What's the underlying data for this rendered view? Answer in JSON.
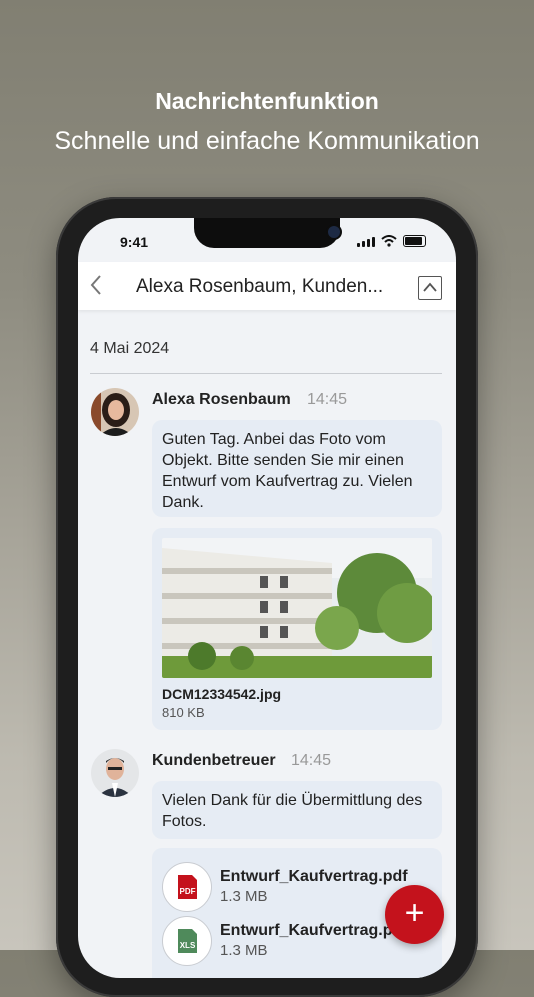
{
  "hero": {
    "title": "Nachrichtenfunktion",
    "subtitle": "Schnelle und einfache Kommunikation"
  },
  "status_bar": {
    "time": "9:41"
  },
  "header": {
    "back_icon": "chevron-left-icon",
    "title": "Alexa Rosenbaum, Kunden...",
    "collapse_icon": "chevron-up-icon"
  },
  "conversation": {
    "date": "4 Mai 2024",
    "messages": [
      {
        "sender": "Alexa Rosenbaum",
        "time": "14:45",
        "text": "Guten Tag. Anbei das Foto vom Objekt. Bitte senden Sie mir einen Entwurf vom Kaufvertrag zu. Vielen Dank.",
        "attachment": {
          "name": "DCM12334542.jpg",
          "size": "810 KB"
        }
      },
      {
        "sender": "Kundenbetreuer",
        "time": "14:45",
        "text": "Vielen Dank für die Übermittlung des Fotos.",
        "files": [
          {
            "name": "Entwurf_Kaufvertrag.pdf",
            "size": "1.3 MB",
            "type": "PDF"
          },
          {
            "name": "Entwurf_Kaufvertrag.p",
            "size": "1.3 MB",
            "type": "XLS"
          }
        ]
      }
    ]
  },
  "fab": {
    "label": "+"
  },
  "colors": {
    "accent": "#c4121c",
    "bubble": "#e6ecf4",
    "background": "#f1f3f6"
  }
}
